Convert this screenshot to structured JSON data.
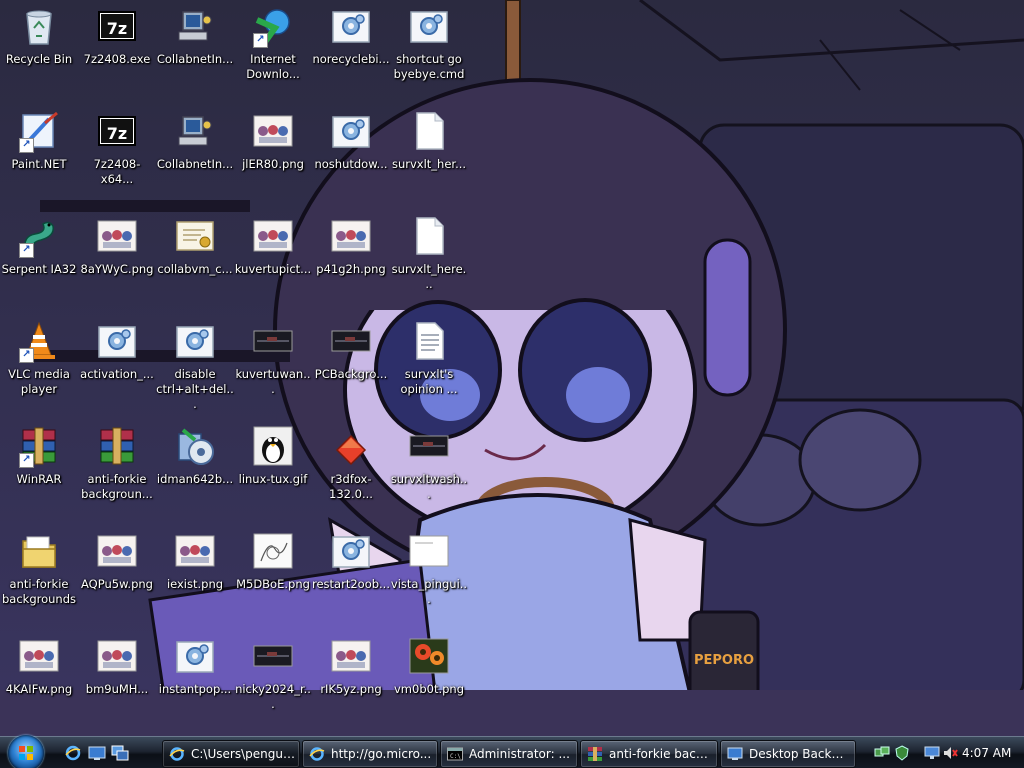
{
  "desktop": {
    "icons": [
      {
        "label": "Recycle Bin",
        "icon": "recycle-bin-icon",
        "shortcut": false
      },
      {
        "label": "7z2408.exe",
        "icon": "sevenzip-icon",
        "shortcut": false
      },
      {
        "label": "CollabnetIn...",
        "icon": "network-computer-icon",
        "shortcut": false
      },
      {
        "label": "Internet\nDownlo...",
        "icon": "idm-globe-icon",
        "shortcut": true
      },
      {
        "label": "norecyclebi...",
        "icon": "settings-file-icon",
        "shortcut": false
      },
      {
        "label": "shortcut go\nbyebye.cmd",
        "icon": "settings-file-icon",
        "shortcut": false
      },
      {
        "label": "Paint.NET",
        "icon": "paintnet-icon",
        "shortcut": true
      },
      {
        "label": "7z2408-x64...",
        "icon": "sevenzip-icon",
        "shortcut": false
      },
      {
        "label": "CollabnetIn...",
        "icon": "network-computer-icon",
        "shortcut": false
      },
      {
        "label": "jlER80.png",
        "icon": "image-thumbnail-icon",
        "shortcut": false
      },
      {
        "label": "noshutdow...",
        "icon": "settings-file-icon",
        "shortcut": false
      },
      {
        "label": "survxlt_her...",
        "icon": "blank-file-icon",
        "shortcut": false
      },
      {
        "label": "Serpent IA32",
        "icon": "serpent-icon",
        "shortcut": true
      },
      {
        "label": "8aYWyC.png",
        "icon": "image-thumbnail-icon",
        "shortcut": false
      },
      {
        "label": "collabvm_c...",
        "icon": "certificate-icon",
        "shortcut": false
      },
      {
        "label": "kuvertupict...",
        "icon": "image-thumbnail-icon",
        "shortcut": false
      },
      {
        "label": "p41g2h.png",
        "icon": "image-thumbnail-icon",
        "shortcut": false
      },
      {
        "label": "survxlt_here...",
        "icon": "blank-file-icon",
        "shortcut": false
      },
      {
        "label": "VLC media\nplayer",
        "icon": "vlc-cone-icon",
        "shortcut": true
      },
      {
        "label": "activation_...",
        "icon": "settings-file-icon",
        "shortcut": false
      },
      {
        "label": "disable\nctrl+alt+del...",
        "icon": "settings-file-icon",
        "shortcut": false
      },
      {
        "label": "kuvertuwan...",
        "icon": "dark-image-icon",
        "shortcut": false
      },
      {
        "label": "PCBackgro...",
        "icon": "dark-image-icon",
        "shortcut": false
      },
      {
        "label": "survxlt's\nopinion ...",
        "icon": "text-document-icon",
        "shortcut": false
      },
      {
        "label": "WinRAR",
        "icon": "winrar-icon",
        "shortcut": true
      },
      {
        "label": "anti-forkie\nbackgroun...",
        "icon": "winrar-icon",
        "shortcut": false
      },
      {
        "label": "idman642b...",
        "icon": "installer-icon",
        "shortcut": false
      },
      {
        "label": "linux-tux.gif",
        "icon": "tux-icon",
        "shortcut": false
      },
      {
        "label": "r3dfox-132.0...",
        "icon": "r3dfox-icon",
        "shortcut": false
      },
      {
        "label": "survxltwash...",
        "icon": "dark-image-icon",
        "shortcut": false
      },
      {
        "label": "anti-forkie\nbackgrounds",
        "icon": "folder-icon",
        "shortcut": false
      },
      {
        "label": "AQPu5w.png",
        "icon": "image-thumbnail-icon",
        "shortcut": false
      },
      {
        "label": "iexist.png",
        "icon": "image-thumbnail-icon",
        "shortcut": false
      },
      {
        "label": "M5DBoE.png",
        "icon": "sketch-image-icon",
        "shortcut": false
      },
      {
        "label": "restart2oob...",
        "icon": "settings-file-icon",
        "shortcut": false
      },
      {
        "label": "vista_pingui...",
        "icon": "white-image-icon",
        "shortcut": false
      },
      {
        "label": "4KAIFw.png",
        "icon": "image-thumbnail-icon",
        "shortcut": false
      },
      {
        "label": "bm9uMH...",
        "icon": "image-thumbnail-icon",
        "shortcut": false
      },
      {
        "label": "instantpop...",
        "icon": "settings-file-icon",
        "shortcut": false
      },
      {
        "label": "nicky2024_r...",
        "icon": "dark-image-icon",
        "shortcut": false
      },
      {
        "label": "rIK5yz.png",
        "icon": "image-thumbnail-icon",
        "shortcut": false
      },
      {
        "label": "vm0b0t.png",
        "icon": "flower-image-icon",
        "shortcut": false
      }
    ]
  },
  "taskbar": {
    "start_button": "start-orb-icon",
    "quick_launch": [
      "ie-icon",
      "show-desktop-icon",
      "switch-windows-icon"
    ],
    "tasks": [
      {
        "label": "C:\\Users\\pengui...",
        "icon": "ie-icon",
        "active": true
      },
      {
        "label": "http://go.micro...",
        "icon": "ie-icon",
        "active": false
      },
      {
        "label": "Administrator: ...",
        "icon": "cmd-icon",
        "active": false
      },
      {
        "label": "anti-forkie back...",
        "icon": "winrar-icon",
        "active": false
      },
      {
        "label": "Desktop Backgr...",
        "icon": "monitor-icon",
        "active": false
      }
    ],
    "tray": {
      "icons": [
        "network-icon",
        "security-icon",
        "display-icon",
        "volume-muted-icon"
      ],
      "clock": "4:07 AM"
    }
  },
  "colors": {
    "wallpaper_base": "#2a2540",
    "wallpaper_accent": "#7a6cc8",
    "hoodie": "#9aa6e6",
    "taskbar": "#141a24"
  }
}
